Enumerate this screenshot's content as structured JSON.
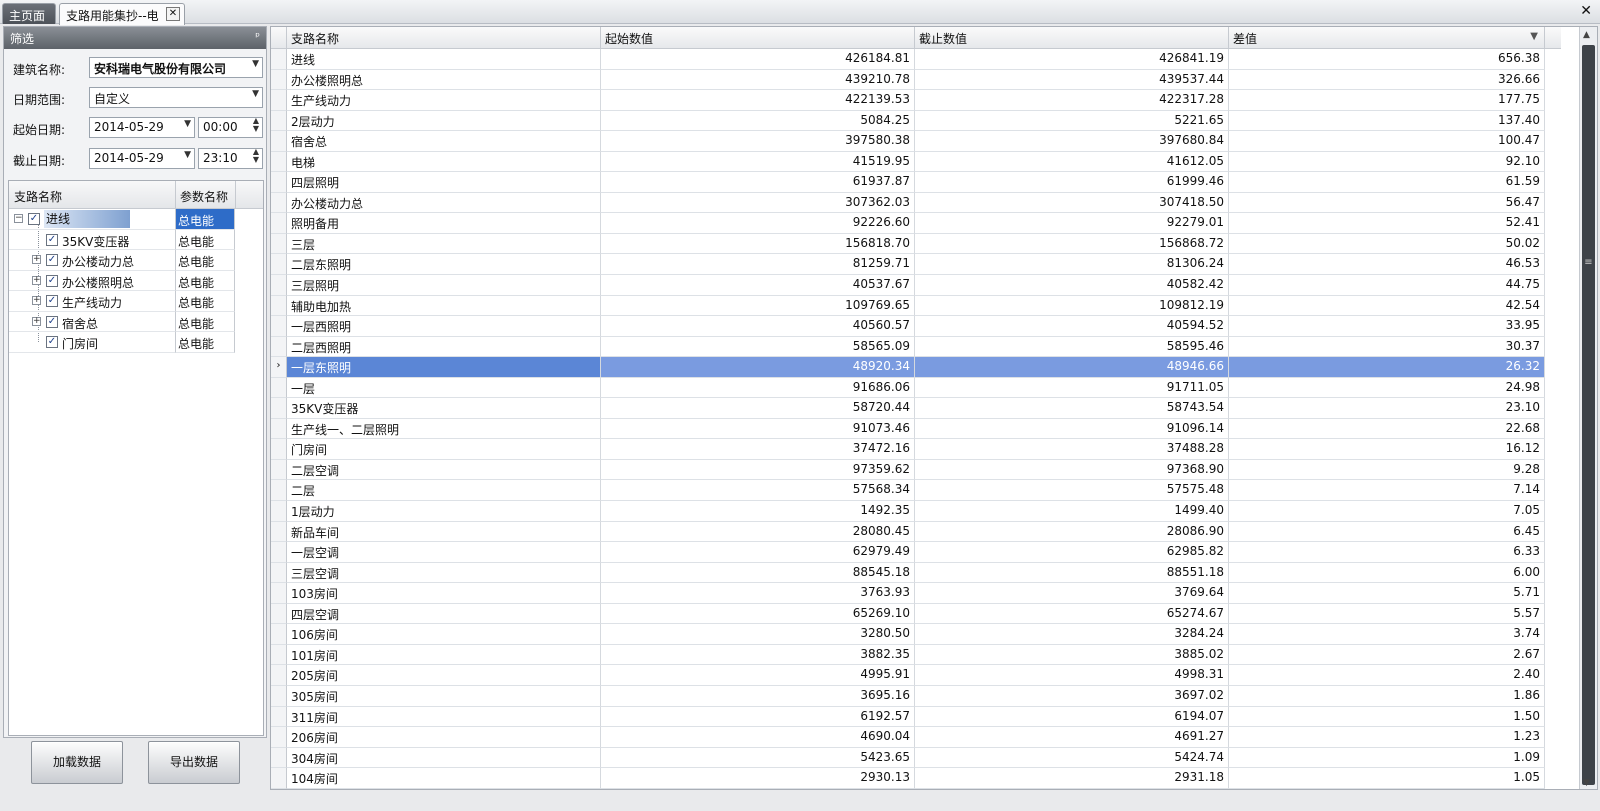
{
  "tabs": {
    "home": "主页面",
    "active": "支路用能集抄--电",
    "close_glyph": "✕",
    "window_close_glyph": "✕"
  },
  "filter": {
    "title": "筛选",
    "pin_glyph": "ᵖ",
    "building_label": "建筑名称:",
    "building_value": "安科瑞电气股份有限公司",
    "date_range_label": "日期范围:",
    "date_range_value": "自定义",
    "start_label": "起始日期:",
    "start_date": "2014-05-29",
    "start_time": "00:00",
    "end_label": "截止日期:",
    "end_date": "2014-05-29",
    "end_time": "23:10"
  },
  "tree": {
    "header_name": "支路名称",
    "header_param": "参数名称",
    "nodes": [
      {
        "label": "进线",
        "param": "总电能",
        "checked": true,
        "expander": "⊟",
        "root": true
      },
      {
        "label": "35KV变压器",
        "param": "总电能",
        "checked": true,
        "expander": ""
      },
      {
        "label": "办公楼动力总",
        "param": "总电能",
        "checked": true,
        "expander": "+"
      },
      {
        "label": "办公楼照明总",
        "param": "总电能",
        "checked": true,
        "expander": "+"
      },
      {
        "label": "生产线动力",
        "param": "总电能",
        "checked": true,
        "expander": "+"
      },
      {
        "label": "宿舍总",
        "param": "总电能",
        "checked": true,
        "expander": "+"
      },
      {
        "label": "门房间",
        "param": "总电能",
        "checked": true,
        "expander": ""
      }
    ]
  },
  "buttons": {
    "load": "加载数据",
    "export": "导出数据"
  },
  "grid": {
    "columns": [
      "支路名称",
      "起始数值",
      "截止数值",
      "差值"
    ],
    "sort_glyph": "▼",
    "selected_indicator": "›",
    "rows": [
      [
        "进线",
        "426184.81",
        "426841.19",
        "656.38"
      ],
      [
        "办公楼照明总",
        "439210.78",
        "439537.44",
        "326.66"
      ],
      [
        "生产线动力",
        "422139.53",
        "422317.28",
        "177.75"
      ],
      [
        "2层动力",
        "5084.25",
        "5221.65",
        "137.40"
      ],
      [
        "宿舍总",
        "397580.38",
        "397680.84",
        "100.47"
      ],
      [
        "电梯",
        "41519.95",
        "41612.05",
        "92.10"
      ],
      [
        "四层照明",
        "61937.87",
        "61999.46",
        "61.59"
      ],
      [
        "办公楼动力总",
        "307362.03",
        "307418.50",
        "56.47"
      ],
      [
        "照明备用",
        "92226.60",
        "92279.01",
        "52.41"
      ],
      [
        "三层",
        "156818.70",
        "156868.72",
        "50.02"
      ],
      [
        "二层东照明",
        "81259.71",
        "81306.24",
        "46.53"
      ],
      [
        "三层照明",
        "40537.67",
        "40582.42",
        "44.75"
      ],
      [
        "辅助电加热",
        "109769.65",
        "109812.19",
        "42.54"
      ],
      [
        "一层西照明",
        "40560.57",
        "40594.52",
        "33.95"
      ],
      [
        "二层西照明",
        "58565.09",
        "58595.46",
        "30.37"
      ],
      [
        "一层东照明",
        "48920.34",
        "48946.66",
        "26.32"
      ],
      [
        "一层",
        "91686.06",
        "91711.05",
        "24.98"
      ],
      [
        "35KV变压器",
        "58720.44",
        "58743.54",
        "23.10"
      ],
      [
        "生产线一、二层照明",
        "91073.46",
        "91096.14",
        "22.68"
      ],
      [
        "门房间",
        "37472.16",
        "37488.28",
        "16.12"
      ],
      [
        "二层空调",
        "97359.62",
        "97368.90",
        "9.28"
      ],
      [
        "二层",
        "57568.34",
        "57575.48",
        "7.14"
      ],
      [
        "1层动力",
        "1492.35",
        "1499.40",
        "7.05"
      ],
      [
        "新品车间",
        "28080.45",
        "28086.90",
        "6.45"
      ],
      [
        "一层空调",
        "62979.49",
        "62985.82",
        "6.33"
      ],
      [
        "三层空调",
        "88545.18",
        "88551.18",
        "6.00"
      ],
      [
        "103房间",
        "3763.93",
        "3769.64",
        "5.71"
      ],
      [
        "四层空调",
        "65269.10",
        "65274.67",
        "5.57"
      ],
      [
        "106房间",
        "3280.50",
        "3284.24",
        "3.74"
      ],
      [
        "101房间",
        "3882.35",
        "3885.02",
        "2.67"
      ],
      [
        "205房间",
        "4995.91",
        "4998.31",
        "2.40"
      ],
      [
        "305房间",
        "3695.16",
        "3697.02",
        "1.86"
      ],
      [
        "311房间",
        "6192.57",
        "6194.07",
        "1.50"
      ],
      [
        "206房间",
        "4690.04",
        "4691.27",
        "1.23"
      ],
      [
        "304房间",
        "5423.65",
        "5424.74",
        "1.09"
      ],
      [
        "104房间",
        "2930.13",
        "2931.18",
        "1.05"
      ]
    ],
    "selected_row": 15
  },
  "scroll": {
    "up_glyph": "▲",
    "down_glyph": "▼",
    "grip_glyph": "≡"
  }
}
